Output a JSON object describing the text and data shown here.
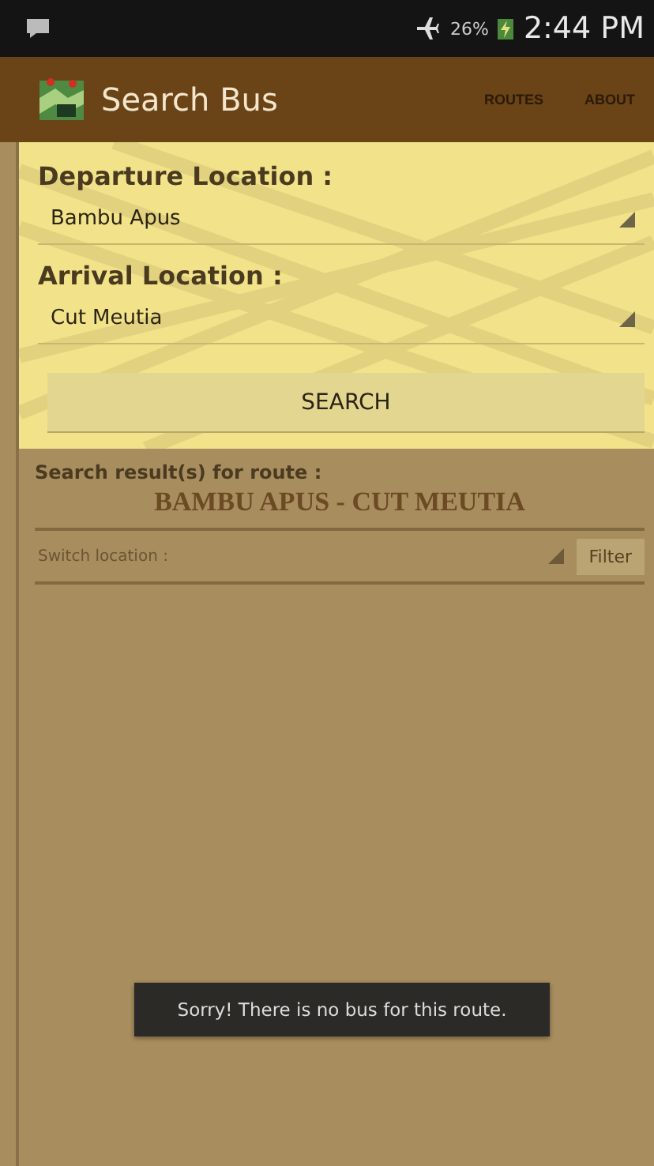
{
  "status_bar": {
    "battery": "26%",
    "time": "2:44 PM"
  },
  "app_bar": {
    "title": "Search Bus",
    "actions": [
      {
        "label": "ROUTES"
      },
      {
        "label": "ABOUT"
      }
    ]
  },
  "form": {
    "fields": [
      {
        "label": "Departure Location :",
        "value": "Bambu Apus"
      },
      {
        "label": "Arrival Location :",
        "value": "Cut Meutia"
      }
    ],
    "button": "SEARCH"
  },
  "results": {
    "heading": "Search result(s) for route :",
    "route": "BAMBU APUS - CUT MEUTIA",
    "switch": {
      "placeholder": "Switch location :"
    },
    "filter_button": "Filter"
  },
  "toast": "Sorry! There is no bus for this route."
}
